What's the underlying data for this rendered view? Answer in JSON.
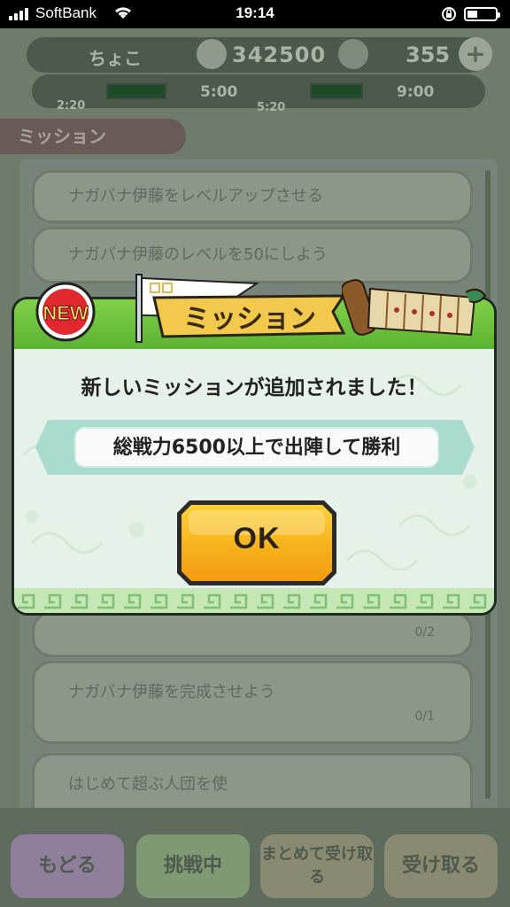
{
  "status_bar": {
    "carrier": "SoftBank",
    "time": "19:14",
    "battery_level": 0.35
  },
  "background": {
    "player_name": "ちょこ",
    "money": "342500",
    "gems": "355",
    "timer_left": "5:00",
    "timer_mid": "5:00",
    "timer_right": "9:00",
    "timer_under_left": "2:20",
    "timer_under_mid": "5:20",
    "mission_tab": "ミッション",
    "cards": [
      "ナガバナ伊藤をレベルアップさせる",
      "ナガバナ伊藤のレベルを50にしよう",
      "ナガバナ伊藤を完成させよう",
      "はじめて超ぶ人団を使"
    ],
    "progress_a": "0/2",
    "progress_b": "0/1",
    "footer_buttons": [
      "もどる",
      "挑戦中",
      "まとめて受け取る",
      "受け取る"
    ]
  },
  "dialog": {
    "badge": "NEW",
    "title": "ミッション",
    "message": "新しいミッションが追加されました！",
    "mission": "総戦力6500以上で出陣して勝利",
    "ok_label": "OK",
    "colors": {
      "header_green": "#5cb332",
      "button_yellow": "#f6b21a",
      "banner_teal": "#a9dccf"
    }
  }
}
